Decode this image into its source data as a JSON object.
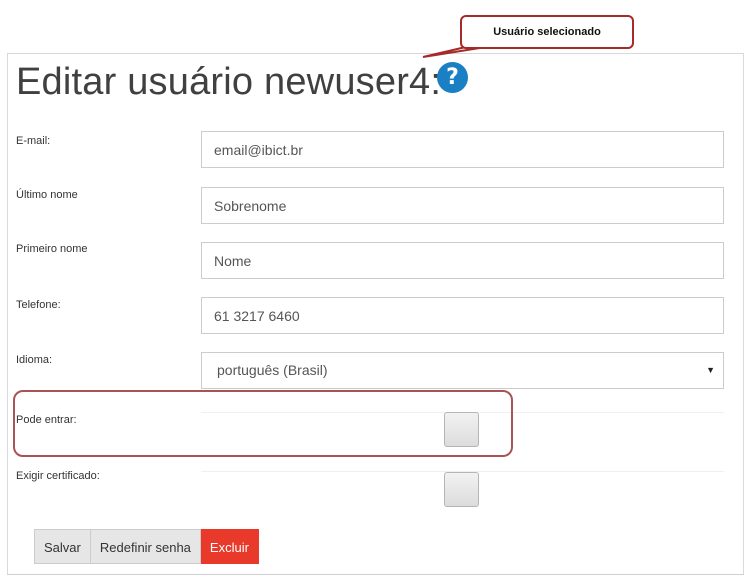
{
  "callout": {
    "text": "Usuário selecionado"
  },
  "page": {
    "title": "Editar usuário newuser4:",
    "help_icon_glyph": "?"
  },
  "form": {
    "email": {
      "label": "E-mail:",
      "value": "email@ibict.br"
    },
    "last_name": {
      "label": "Último nome",
      "placeholder": "Sobrenome"
    },
    "first_name": {
      "label": "Primeiro nome",
      "placeholder": "Nome"
    },
    "phone": {
      "label": "Telefone:",
      "value": "61 3217 6460"
    },
    "language": {
      "label": "Idioma:",
      "selected": "português (Brasil)",
      "caret": "▼"
    },
    "can_login": {
      "label": "Pode entrar:",
      "checked": false
    },
    "require_certificate": {
      "label": "Exigir certificado:",
      "checked": false
    }
  },
  "buttons": {
    "save": "Salvar",
    "reset_password": "Redefinir senha",
    "delete": "Excluir"
  },
  "colors": {
    "accent_help": "#1b7fc4",
    "danger": "#e8392b",
    "annotation": "#a52a2a"
  }
}
